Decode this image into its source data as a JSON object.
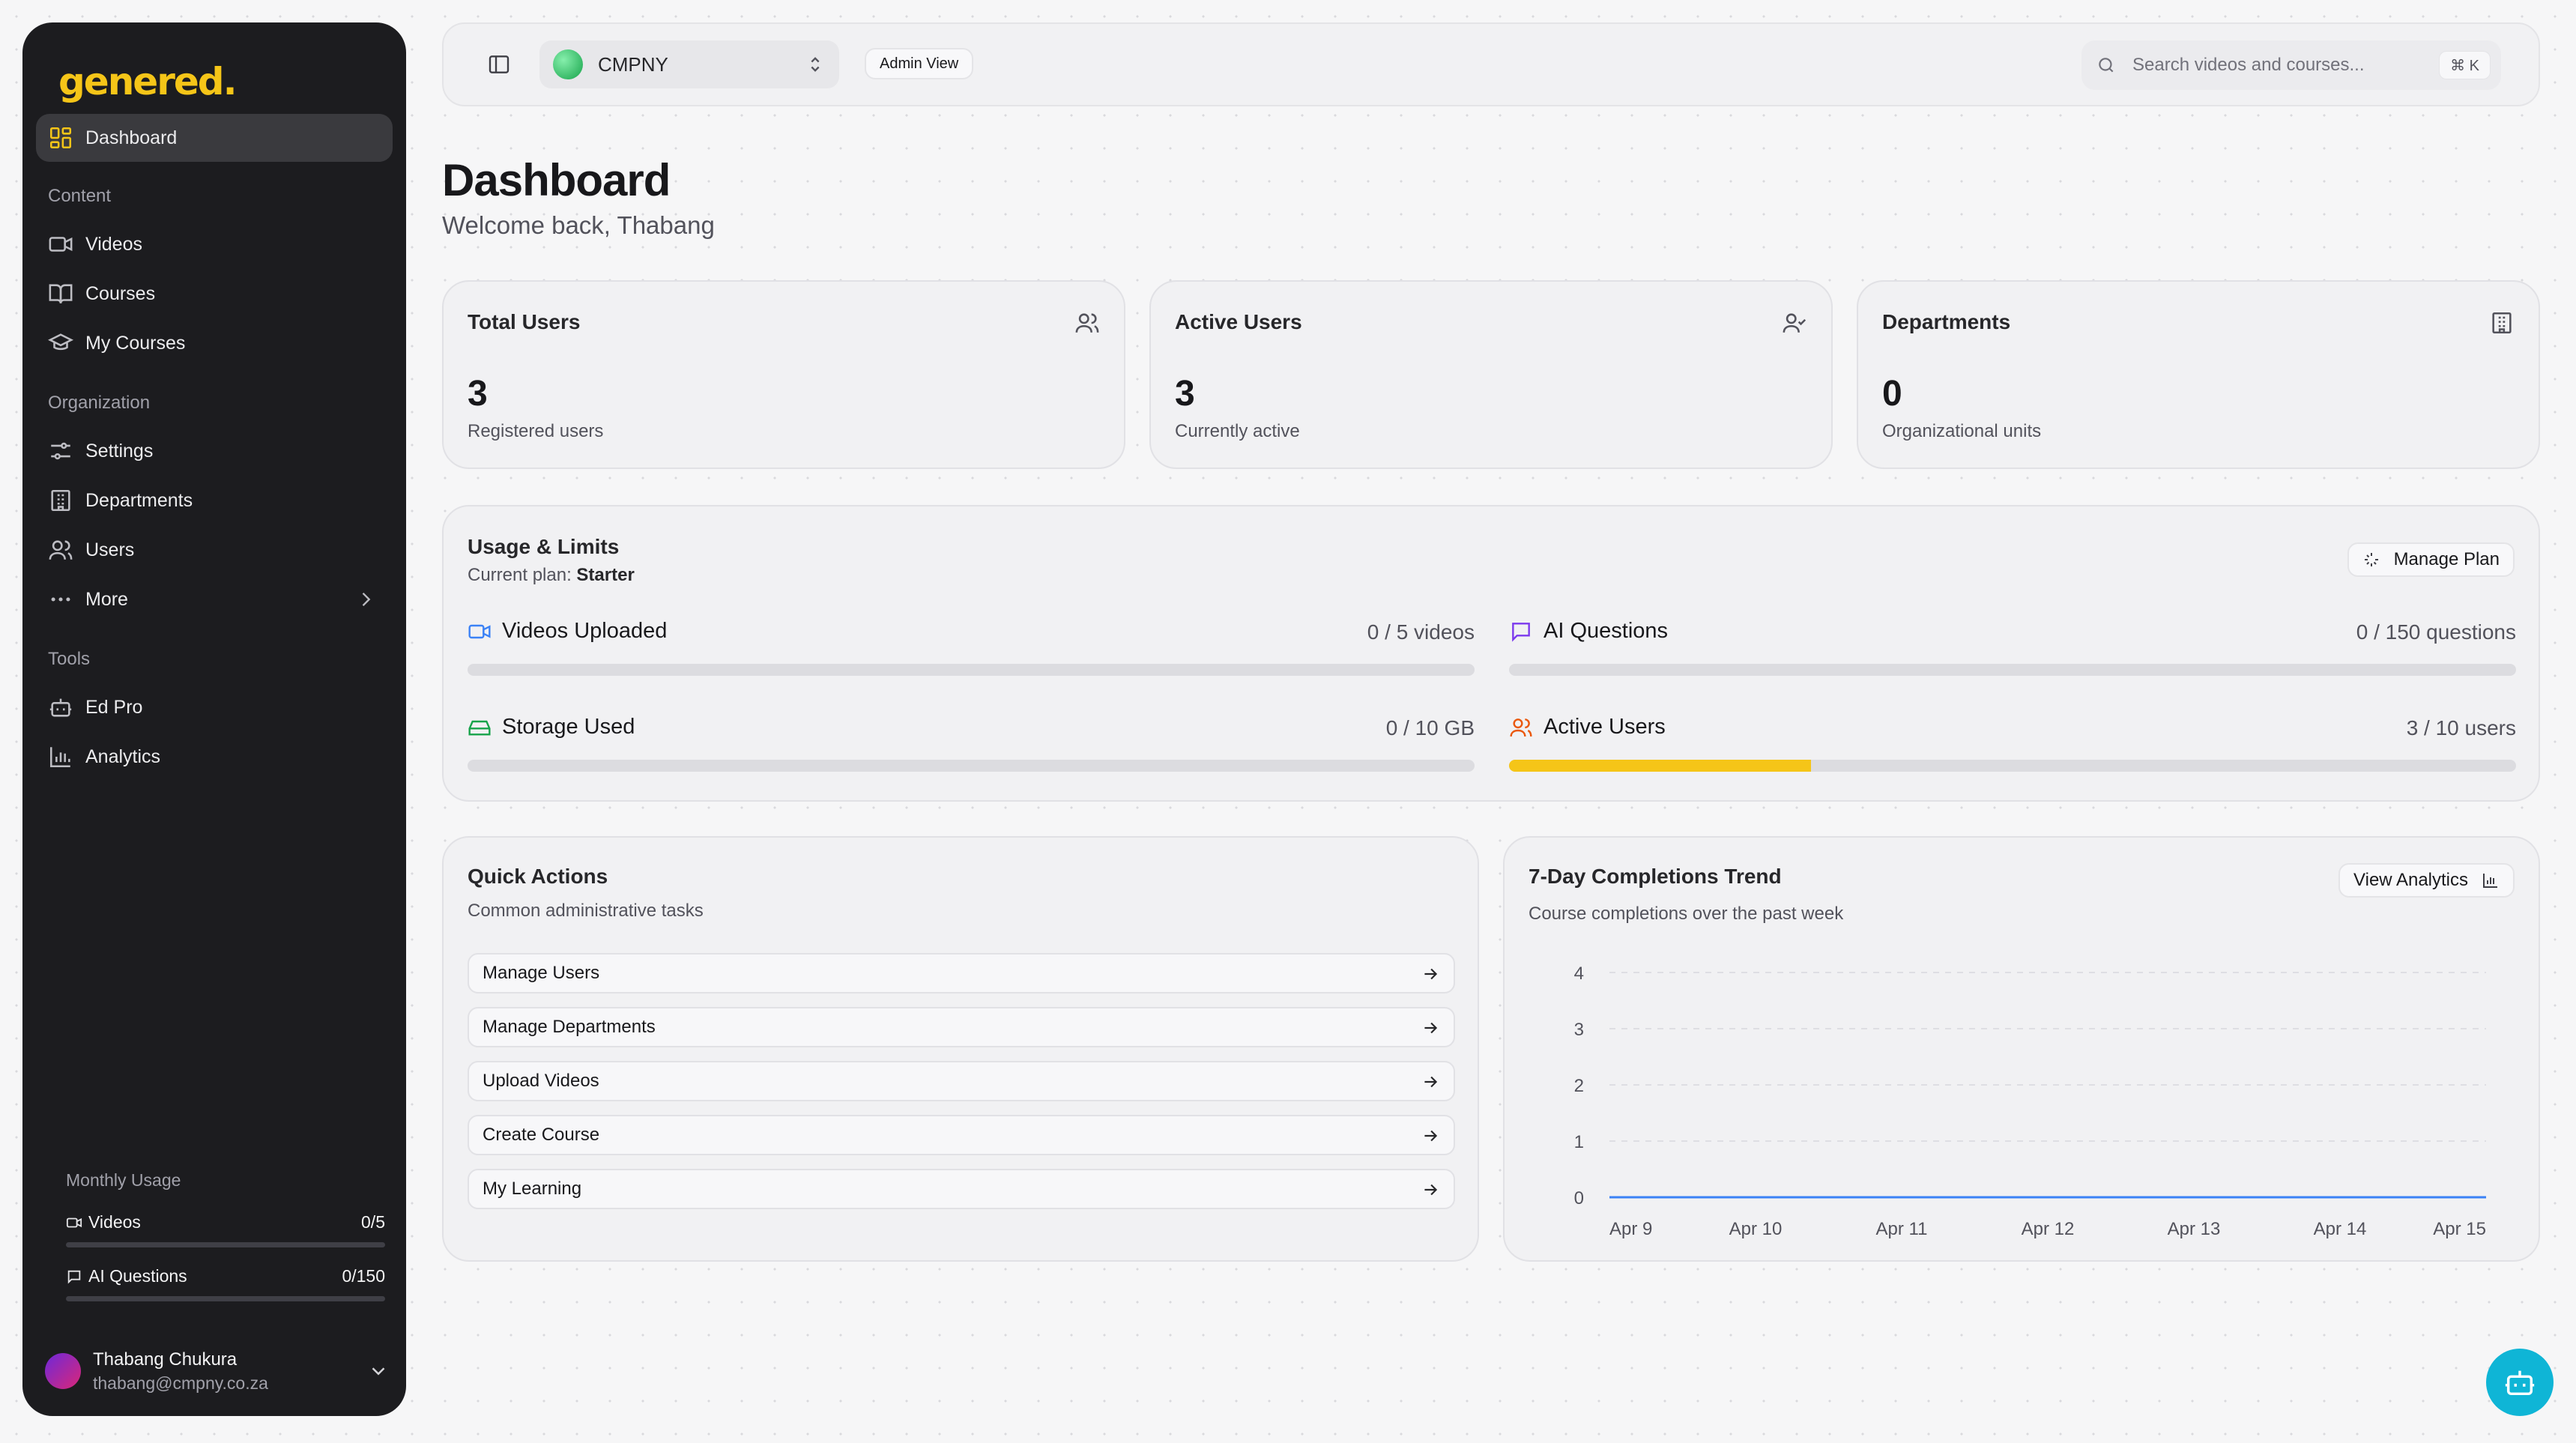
{
  "brand": {
    "logo_text": "genered.",
    "accent": "#f5c518"
  },
  "sidebar": {
    "dashboard": "Dashboard",
    "sections": {
      "content": "Content",
      "organization": "Organization",
      "tools": "Tools"
    },
    "items": {
      "videos": "Videos",
      "courses": "Courses",
      "my_courses": "My Courses",
      "settings": "Settings",
      "departments": "Departments",
      "users": "Users",
      "more": "More",
      "ed_pro": "Ed Pro",
      "analytics": "Analytics"
    },
    "monthly_usage": {
      "title": "Monthly Usage",
      "videos_label": "Videos",
      "videos_value": "0/5",
      "videos_fraction": 0,
      "ai_label": "AI Questions",
      "ai_value": "0/150",
      "ai_fraction": 0
    },
    "user": {
      "name": "Thabang Chukura",
      "email": "thabang@cmpny.co.za"
    }
  },
  "topbar": {
    "company": "CMPNY",
    "badge": "Admin View",
    "search_placeholder": "Search videos and courses...",
    "shortcut": "⌘ K"
  },
  "header": {
    "title": "Dashboard",
    "subtitle": "Welcome back, Thabang"
  },
  "stats": [
    {
      "title": "Total Users",
      "value": "3",
      "desc": "Registered users",
      "icon": "users-icon"
    },
    {
      "title": "Active Users",
      "value": "3",
      "desc": "Currently active",
      "icon": "user-check-icon"
    },
    {
      "title": "Departments",
      "value": "0",
      "desc": "Organizational units",
      "icon": "building-icon"
    }
  ],
  "usage": {
    "title": "Usage & Limits",
    "plan_label": "Current plan:",
    "plan_name": "Starter",
    "manage_plan": "Manage Plan",
    "metrics": [
      {
        "label": "Videos Uploaded",
        "value": "0 / 5 videos",
        "fraction": 0,
        "icon_color": "#3b82f6"
      },
      {
        "label": "AI Questions",
        "value": "0 / 150 questions",
        "fraction": 0,
        "icon_color": "#7c3aed"
      },
      {
        "label": "Storage Used",
        "value": "0 / 10 GB",
        "fraction": 0,
        "icon_color": "#16a34a"
      },
      {
        "label": "Active Users",
        "value": "3 / 10 users",
        "fraction": 0.3,
        "icon_color": "#ea580c"
      }
    ]
  },
  "quick_actions": {
    "title": "Quick Actions",
    "desc": "Common administrative tasks",
    "items": [
      "Manage Users",
      "Manage Departments",
      "Upload Videos",
      "Create Course",
      "My Learning"
    ]
  },
  "trend": {
    "title": "7-Day Completions Trend",
    "desc": "Course completions over the past week",
    "button": "View Analytics"
  },
  "chart_data": {
    "type": "line",
    "categories": [
      "Apr 9",
      "Apr 10",
      "Apr 11",
      "Apr 12",
      "Apr 13",
      "Apr 14",
      "Apr 15"
    ],
    "values": [
      0,
      0,
      0,
      0,
      0,
      0,
      0
    ],
    "yticks": [
      0,
      1,
      2,
      3,
      4
    ],
    "ylim": [
      0,
      4
    ],
    "grid": "dashed-horizontal",
    "line_color": "#3b82f6"
  }
}
